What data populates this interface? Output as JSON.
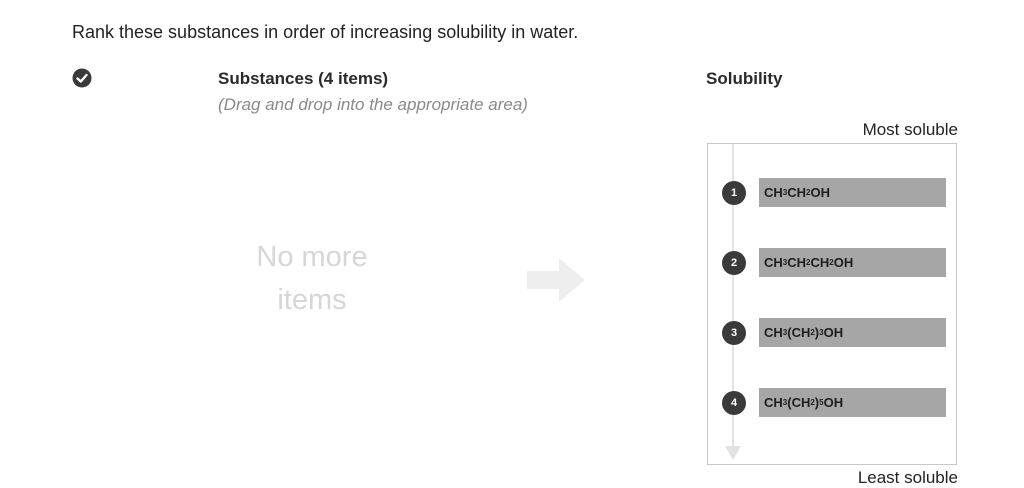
{
  "question": "Rank these substances in order of increasing solubility in water.",
  "source": {
    "title": "Substances (4 items)",
    "subtitle": "(Drag and drop into the appropriate area)",
    "empty_line1": "No more",
    "empty_line2": "items"
  },
  "target": {
    "title": "Solubility",
    "top_label": "Most soluble",
    "bottom_label": "Least soluble",
    "items": [
      {
        "rank": "1",
        "parts": [
          [
            "CH",
            ""
          ],
          [
            "3",
            "sub"
          ],
          [
            "CH",
            ""
          ],
          [
            "2",
            "sub"
          ],
          [
            "OH",
            ""
          ]
        ]
      },
      {
        "rank": "2",
        "parts": [
          [
            "CH",
            ""
          ],
          [
            "3",
            "sub"
          ],
          [
            "CH",
            ""
          ],
          [
            "2",
            "sub"
          ],
          [
            "CH",
            ""
          ],
          [
            "2",
            "sub"
          ],
          [
            "OH",
            ""
          ]
        ]
      },
      {
        "rank": "3",
        "parts": [
          [
            "CH",
            ""
          ],
          [
            "3",
            "sub"
          ],
          [
            "(CH",
            ""
          ],
          [
            "2",
            "sub"
          ],
          [
            ")",
            ""
          ],
          [
            "3",
            "sub"
          ],
          [
            "OH",
            ""
          ]
        ]
      },
      {
        "rank": "4",
        "parts": [
          [
            "CH",
            ""
          ],
          [
            "3",
            "sub"
          ],
          [
            "(CH",
            ""
          ],
          [
            "2",
            "sub"
          ],
          [
            ")",
            ""
          ],
          [
            "5",
            "sub"
          ],
          [
            "OH",
            ""
          ]
        ]
      }
    ]
  },
  "colors": {
    "item_bg": "#a6a6a6",
    "badge_bg": "#3a3a3a",
    "check_bg": "#3a3a3a",
    "empty_text": "#d6d6d6",
    "arrow": "#eeeeee"
  },
  "icons": {
    "status": "check-circle-icon",
    "move": "right-arrow-icon"
  }
}
